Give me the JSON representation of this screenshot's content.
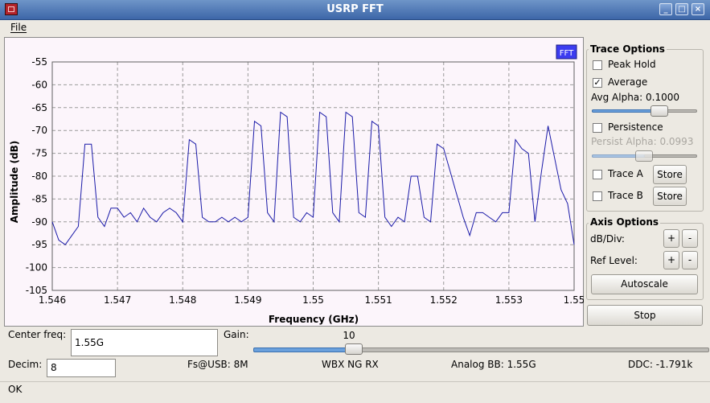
{
  "window": {
    "title": "USRP FFT",
    "controls": [
      "_",
      "□",
      "×"
    ]
  },
  "menu": {
    "file": "File"
  },
  "plot": {
    "legend": "FFT",
    "xlabel": "Frequency (GHz)",
    "ylabel": "Amplitude (dB)",
    "xticks": [
      "1.546",
      "1.547",
      "1.548",
      "1.549",
      "1.55",
      "1.551",
      "1.552",
      "1.553",
      "1.55"
    ],
    "yticks": [
      "-55",
      "-60",
      "-65",
      "-70",
      "-75",
      "-80",
      "-85",
      "-90",
      "-95",
      "-100",
      "-105"
    ],
    "trace_color": "#1a1aa8",
    "legend_color": "#3c3cf0"
  },
  "chart_data": {
    "type": "line",
    "xlabel": "Frequency (GHz)",
    "ylabel": "Amplitude (dB)",
    "xlim": [
      1.546,
      1.554
    ],
    "ylim": [
      -105,
      -55
    ],
    "grid": true,
    "legend": "top-right",
    "series": [
      {
        "name": "FFT",
        "x": [
          1.546,
          1.5461,
          1.5462,
          1.5463,
          1.5464,
          1.5465,
          1.5466,
          1.5467,
          1.5468,
          1.5469,
          1.547,
          1.5471,
          1.5472,
          1.5473,
          1.5474,
          1.5475,
          1.5476,
          1.5477,
          1.5478,
          1.5479,
          1.548,
          1.5481,
          1.5482,
          1.5483,
          1.5484,
          1.5485,
          1.5486,
          1.5487,
          1.5488,
          1.5489,
          1.549,
          1.5491,
          1.5492,
          1.5493,
          1.5494,
          1.5495,
          1.5496,
          1.5497,
          1.5498,
          1.5499,
          1.55,
          1.5501,
          1.5502,
          1.5503,
          1.5504,
          1.5505,
          1.5506,
          1.5507,
          1.5508,
          1.5509,
          1.551,
          1.5511,
          1.5512,
          1.5513,
          1.5514,
          1.5515,
          1.5516,
          1.5517,
          1.5518,
          1.5519,
          1.552,
          1.5521,
          1.5522,
          1.5523,
          1.5524,
          1.5525,
          1.5526,
          1.5527,
          1.5528,
          1.5529,
          1.553,
          1.5531,
          1.5532,
          1.5533,
          1.5534,
          1.5535,
          1.5536,
          1.5537,
          1.5538,
          1.5539,
          1.554
        ],
        "y": [
          -90,
          -94,
          -95,
          -93,
          -91,
          -73,
          -73,
          -89,
          -91,
          -87,
          -87,
          -89,
          -88,
          -90,
          -87,
          -89,
          -90,
          -88,
          -87,
          -88,
          -90,
          -72,
          -73,
          -89,
          -90,
          -90,
          -89,
          -90,
          -89,
          -90,
          -89,
          -68,
          -69,
          -88,
          -90,
          -66,
          -67,
          -89,
          -90,
          -88,
          -89,
          -66,
          -67,
          -88,
          -90,
          -66,
          -67,
          -88,
          -89,
          -68,
          -69,
          -89,
          -91,
          -89,
          -90,
          -80,
          -80,
          -89,
          -90,
          -73,
          -74,
          -79,
          -84,
          -89,
          -93,
          -88,
          -88,
          -89,
          -90,
          -88,
          -88,
          -72,
          -74,
          -75,
          -90,
          -79,
          -69,
          -76,
          -83,
          -86,
          -95
        ]
      }
    ]
  },
  "trace_options": {
    "title": "Trace Options",
    "peak_hold": {
      "label": "Peak Hold",
      "checked": false
    },
    "average": {
      "label": "Average",
      "checked": true,
      "mark": "✓"
    },
    "avg_alpha": {
      "label": "Avg Alpha: 0.1000",
      "value": 0.1
    },
    "persistence": {
      "label": "Persistence",
      "checked": false
    },
    "persist_alpha": {
      "label": "Persist Alpha: 0.0993",
      "value": 0.0993
    },
    "trace_a": {
      "label": "Trace A",
      "store": "Store"
    },
    "trace_b": {
      "label": "Trace B",
      "store": "Store"
    }
  },
  "axis_options": {
    "title": "Axis Options",
    "db_div": "dB/Div:",
    "ref_level": "Ref Level:",
    "plus": "+",
    "minus": "-",
    "autoscale": "Autoscale"
  },
  "stop_label": "Stop",
  "controls": {
    "center_freq_label": "Center freq:",
    "center_freq_value": "1.55G",
    "gain_label": "Gain:",
    "gain_value": "10",
    "gain_fraction": 0.22,
    "decim_label": "Decim:",
    "decim_value": "8",
    "fs_usb": "Fs@USB: 8M",
    "board": "WBX NG RX",
    "analog_bb": "Analog BB: 1.55G",
    "ddc": "DDC: -1.791k"
  },
  "status": "OK"
}
